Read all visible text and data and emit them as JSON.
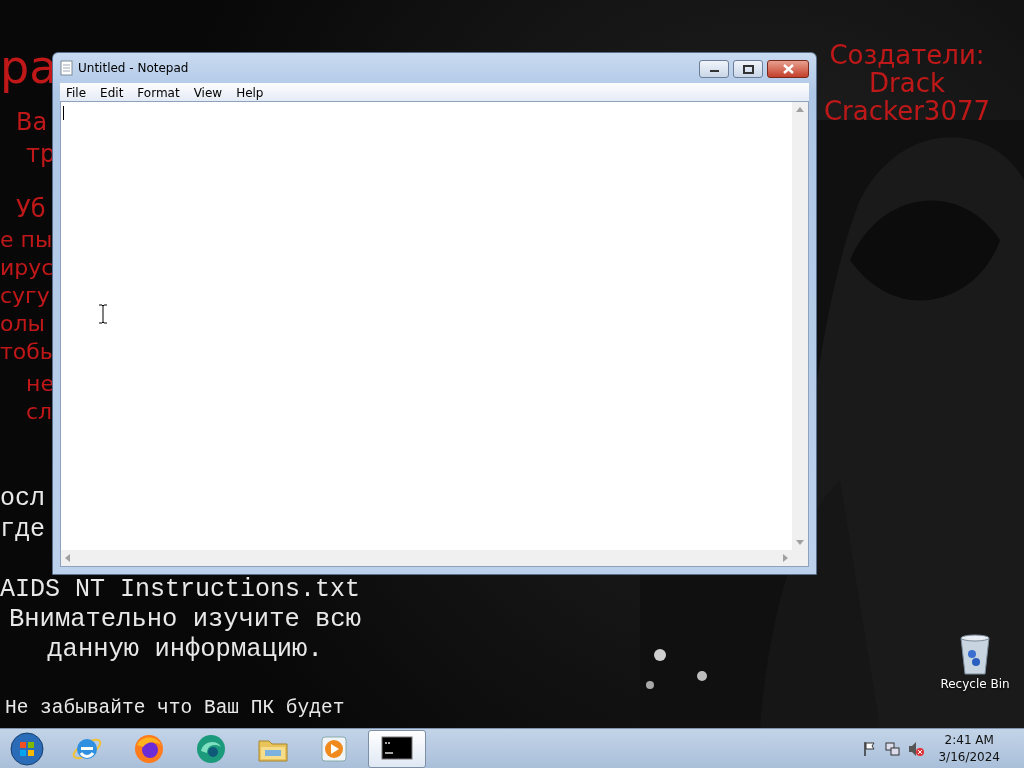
{
  "wallpaper": {
    "red_fragments": [
      "ра",
      "Ва",
      "тр",
      "Уб",
      "е пы",
      "ирус",
      "сугу",
      "олы",
      "тобы",
      "не",
      "сл"
    ],
    "credits": [
      "Создатели:",
      "Drack",
      "Cracker3077"
    ],
    "white_fragments": [
      "осл",
      "где"
    ],
    "instructions": [
      "AIDS NT Instructions.txt",
      "Внимательно изучите всю",
      "данную информацию.",
      "Не забывайте что Ваш ПК будет"
    ]
  },
  "window": {
    "title": "Untitled - Notepad",
    "menu": [
      "File",
      "Edit",
      "Format",
      "View",
      "Help"
    ]
  },
  "desktop_icons": [
    {
      "label": "Recycle Bin"
    }
  ],
  "taskbar": {
    "apps": [
      {
        "kind": "ie",
        "selected": false
      },
      {
        "kind": "firefox",
        "selected": false
      },
      {
        "kind": "swirl",
        "selected": false
      },
      {
        "kind": "folder",
        "selected": false
      },
      {
        "kind": "player",
        "selected": false
      },
      {
        "kind": "cmd",
        "selected": true
      }
    ],
    "clock": {
      "time": "2:41 AM",
      "date": "3/16/2024"
    }
  }
}
